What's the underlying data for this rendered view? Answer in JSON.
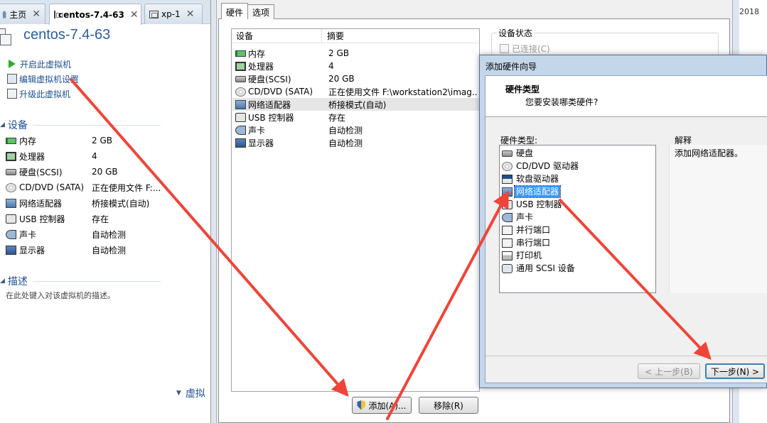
{
  "tabs": [
    {
      "label": "主页",
      "icon": "home-icon"
    },
    {
      "label": "centos-7.4-63",
      "icon": "vm-icon"
    },
    {
      "label": "xp-1",
      "icon": "vm-icon"
    }
  ],
  "vm": {
    "title": "centos-7.4-63",
    "actions": [
      "开启此虚拟机",
      "编辑虚拟机设置",
      "升级此虚拟机"
    ],
    "devices_heading": "设备",
    "devices": [
      {
        "name": "内存",
        "value": "2 GB",
        "icon": "memory-icon"
      },
      {
        "name": "处理器",
        "value": "4",
        "icon": "cpu-icon"
      },
      {
        "name": "硬盘(SCSI)",
        "value": "20 GB",
        "icon": "harddisk-icon"
      },
      {
        "name": "CD/DVD (SATA)",
        "value": "正在使用文件 F:...",
        "icon": "cd-icon"
      },
      {
        "name": "网络适配器",
        "value": "桥接模式(自动)",
        "icon": "network-icon"
      },
      {
        "name": "USB 控制器",
        "value": "存在",
        "icon": "usb-icon"
      },
      {
        "name": "声卡",
        "value": "自动检测",
        "icon": "sound-icon"
      },
      {
        "name": "显示器",
        "value": "自动检测",
        "icon": "display-icon"
      }
    ],
    "desc_heading": "描述",
    "desc_placeholder": "在此处键入对该虚拟机的描述。",
    "collapsed_heading": "虚拟"
  },
  "settings": {
    "tabs": [
      "硬件",
      "选项"
    ],
    "col_device": "设备",
    "col_summary": "摘要",
    "hardware": [
      {
        "name": "内存",
        "value": "2 GB",
        "icon": "memory-icon"
      },
      {
        "name": "处理器",
        "value": "4",
        "icon": "cpu-icon"
      },
      {
        "name": "硬盘(SCSI)",
        "value": "20 GB",
        "icon": "harddisk-icon"
      },
      {
        "name": "CD/DVD (SATA)",
        "value": "正在使用文件 F:\\workstation2\\imag...",
        "icon": "cd-icon"
      },
      {
        "name": "网络适配器",
        "value": "桥接模式(自动)",
        "icon": "network-icon",
        "selected": true
      },
      {
        "name": "USB 控制器",
        "value": "存在",
        "icon": "usb-icon"
      },
      {
        "name": "声卡",
        "value": "自动检测",
        "icon": "sound-icon"
      },
      {
        "name": "显示器",
        "value": "自动检测",
        "icon": "display-icon"
      }
    ],
    "device_status": "设备状态",
    "connected": "已连接(C)",
    "add_button": "添加(A)...",
    "remove_button": "移除(R)"
  },
  "right_edge_text": "2018",
  "wizard": {
    "title": "添加硬件向导",
    "header_title": "硬件类型",
    "header_subtitle": "您要安装哪类硬件?",
    "list_label": "硬件类型:",
    "types": [
      {
        "name": "硬盘",
        "icon": "harddisk-icon"
      },
      {
        "name": "CD/DVD 驱动器",
        "icon": "cd-icon"
      },
      {
        "name": "软盘驱动器",
        "icon": "floppy-icon"
      },
      {
        "name": "网络适配器",
        "icon": "network-icon",
        "selected": true
      },
      {
        "name": "USB 控制器",
        "icon": "usb-icon"
      },
      {
        "name": "声卡",
        "icon": "sound-icon"
      },
      {
        "name": "并行端口",
        "icon": "parallel-port-icon"
      },
      {
        "name": "串行端口",
        "icon": "serial-port-icon"
      },
      {
        "name": "打印机",
        "icon": "printer-icon"
      },
      {
        "name": "通用 SCSI 设备",
        "icon": "scsi-icon"
      }
    ],
    "explain_label": "解释",
    "explain_text": "添加网络适配器。",
    "back_button": "< 上一步(B)",
    "next_button": "下一步(N) >"
  },
  "colors": {
    "annotation_arrow": "#f04438",
    "link_blue": "#1d4f91",
    "selection": "#3399ff"
  }
}
